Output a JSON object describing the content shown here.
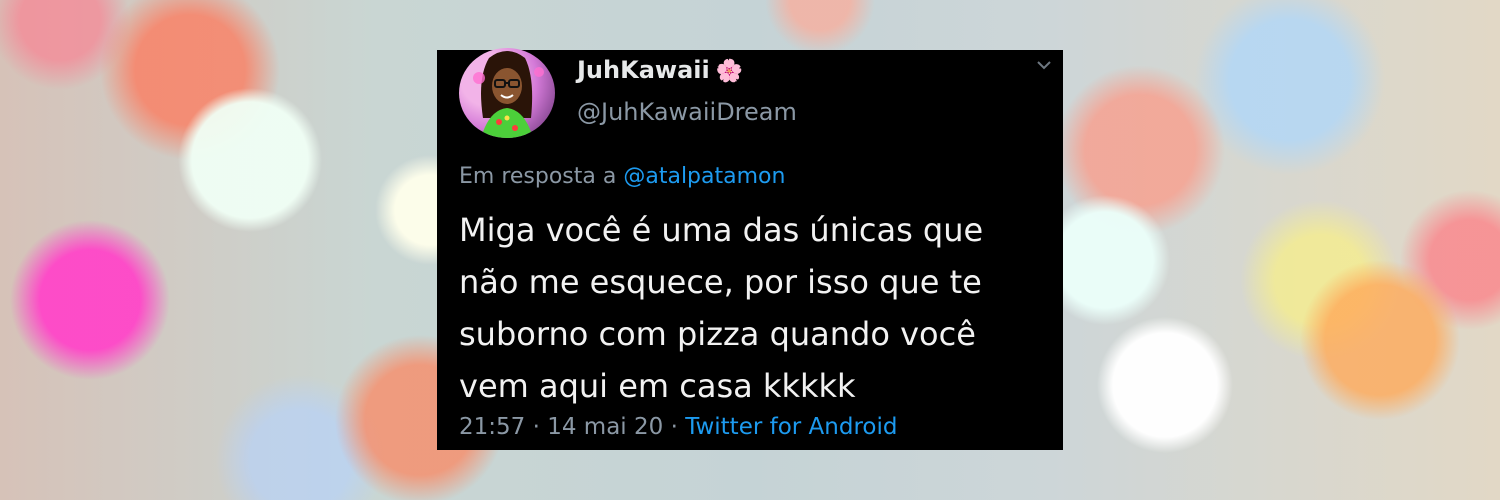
{
  "tweet": {
    "display_name": "JuhKawaii",
    "name_emoji": "🌸",
    "handle": "@JuhKawaiiDream",
    "reply_prefix": "Em resposta a",
    "reply_to": "@atalpatamon",
    "text_lines": [
      "Miga você é uma das únicas que",
      "não me esquece, por isso que te",
      "suborno com pizza quando você",
      "vem aqui em casa kkkkk"
    ],
    "time": "21:57",
    "date": "14 mai 20",
    "separator": "·",
    "client": "Twitter for Android"
  },
  "icons": {
    "menu": "chevron-down-icon",
    "avatar": "avatar"
  },
  "colors": {
    "card_bg": "#000000",
    "link": "#1d9bf0",
    "muted": "#8b98a5"
  }
}
